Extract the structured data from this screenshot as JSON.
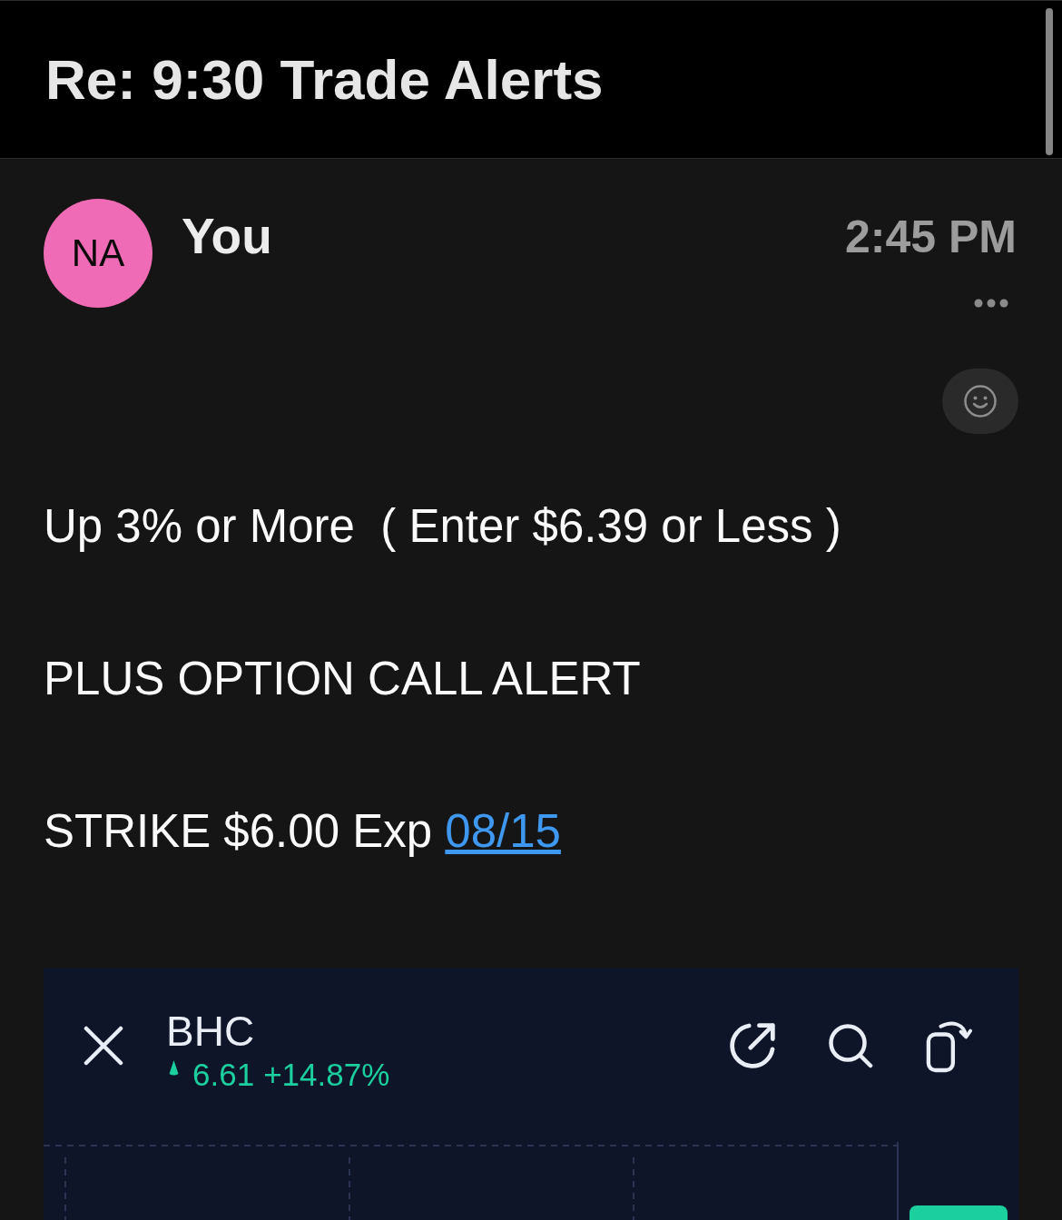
{
  "thread": {
    "title": "Re: 9:30 Trade Alerts"
  },
  "message": {
    "sender": {
      "initials": "NA",
      "name": "You"
    },
    "time": "2:45 PM",
    "lines": [
      {
        "text": "Up 3% or More  ( Enter $6.39 or Less )"
      },
      {
        "text": "PLUS OPTION CALL ALERT"
      },
      {
        "text": "STRIKE $6.00 Exp",
        "link": "08/15"
      }
    ]
  },
  "stock_card": {
    "symbol": "BHC",
    "rising": true,
    "price": "6.61",
    "change": "+14.87%"
  }
}
